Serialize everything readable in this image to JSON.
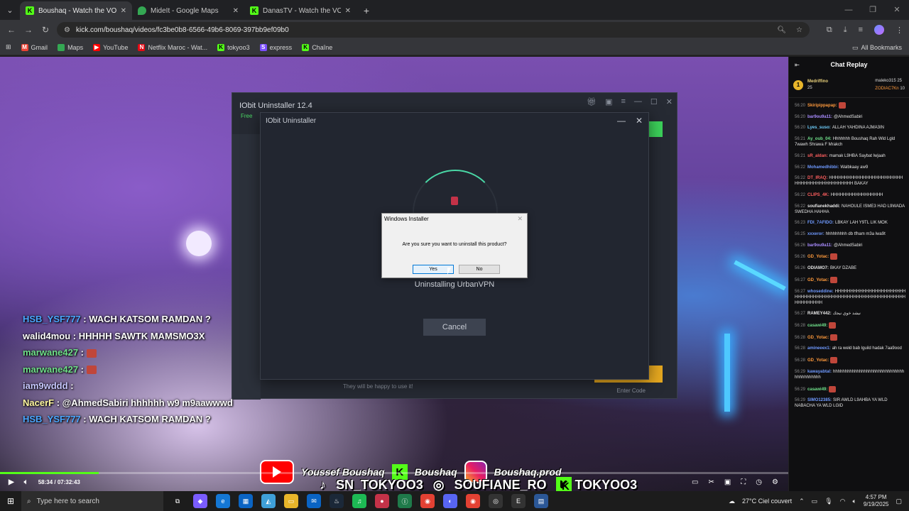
{
  "tabs": [
    {
      "title": "Boushaq - Watch the VOD on Kick",
      "icon": "kick",
      "active": true
    },
    {
      "title": "MideIt - Google Maps",
      "icon": "maps",
      "active": false
    },
    {
      "title": "DanasTV - Watch the VOD on Kick",
      "icon": "kick",
      "active": false
    }
  ],
  "address": "kick.com/boushaq/videos/fc3be0b8-6566-49b6-8069-397bb9ef09b0",
  "bookmarks": [
    "Gmail",
    "Maps",
    "YouTube",
    "Netflix Maroc - Wat...",
    "tokyoo3",
    "express",
    "Chaîne"
  ],
  "all_bookmarks": "All Bookmarks",
  "overlay_chat": [
    {
      "user": "HSB_YSF777",
      "text": " : WACH KATSOM RAMDAN ?"
    },
    {
      "user": "walid4mou",
      "text": " : HHHHH SAWTK MAMSMO3X"
    },
    {
      "user": "marwane427",
      "text": " : "
    },
    {
      "user": "marwane427",
      "text": " : "
    },
    {
      "user": "iam9wddd",
      "text": " : "
    },
    {
      "user": "NacerF",
      "text": " : @AhmedSabiri hhhhhh w9 m9aawwwd"
    },
    {
      "user": "HSB_YSF777",
      "text": " : WACH KATSOM RAMDAN ?"
    }
  ],
  "iobit": {
    "title": "IObit Uninstaller 12.4",
    "free": "Free",
    "dialog_title": "IObit Uninstaller",
    "status": "Uninstalling UrbanVPN",
    "cancel": "Cancel",
    "footer": "They will be happy to use it!",
    "footer2": "Enter Code"
  },
  "windows_installer": {
    "title": "Windows Installer",
    "message": "Are you sure you want to uninstall this product?",
    "yes": "Yes",
    "no": "No"
  },
  "banner": {
    "youtube": "Youssef Boushaq",
    "kick": "Boushaq",
    "instagram": "Boushaq.prod",
    "tiktok": "SN_TOKYOO3",
    "instagram2": "SOUFIANE_RO",
    "kick2": "TOKYOO3"
  },
  "player": {
    "time": "58:34 / 07:32:43",
    "progress": 0.125
  },
  "chat_replay": {
    "title": "Chat Replay",
    "leader_name": "Medriffino",
    "leader_count": "25",
    "leader2": "maleko315",
    "leader2_count": "25",
    "leader3": "ZODIAC7Kn",
    "leader3_count": "10",
    "messages": [
      {
        "t": "56:20",
        "n": "Skiripippapap",
        "c": "#ff9a3c",
        "m": ""
      },
      {
        "t": "56:20",
        "n": "bar9ou9a11",
        "c": "#a98cff",
        "m": "@AhmedSabiri"
      },
      {
        "t": "56:20",
        "n": "Lyes_suso",
        "c": "#6fd0ff",
        "m": "ALLAH YAHDINA AJMA3IN"
      },
      {
        "t": "56:21",
        "n": "Ay_oub_04",
        "c": "#6fe08a",
        "m": "Hhhhhhh Boushaq Rah Wld Lgld 7wawh Shrawa F Mrakch"
      },
      {
        "t": "56:21",
        "n": "sR_aldan",
        "c": "#ff5f5f",
        "m": "mamak L9HBA Saybat lwjaah"
      },
      {
        "t": "56:22",
        "n": "Mohamedhibbi",
        "c": "#6f9aff",
        "m": "Walbkaay aw9"
      },
      {
        "t": "56:22",
        "n": "DT_IRAQ",
        "c": "#ff5f5f",
        "m": "HHHHHHHHHHHHHHHHHHHHHHHH HHHHHHHHHHHHHHHHHHH BAKAY"
      },
      {
        "t": "56:22",
        "n": "CLIPS_4K",
        "c": "#ff5f5f",
        "m": "HHHHHHHHHHHHHHHHH"
      },
      {
        "t": "56:22",
        "n": "soufianekhaddi",
        "c": "#e6e6e6",
        "m": "NAHOULE ISME3 HAD L9WADA SWEDHA HAHHA"
      },
      {
        "t": "56:23",
        "n": "FDI_7AFIDO",
        "c": "#6f9aff",
        "m": "LBKAY LAH Y9TL LIK MOK"
      },
      {
        "t": "56:25",
        "n": "xxxeror",
        "c": "#6f9aff",
        "m": "hhhhhhhhh db tfham m3a lwa9t"
      },
      {
        "t": "56:26",
        "n": "bar9ou9a11",
        "c": "#a98cff",
        "m": "@AhmedSabiri"
      },
      {
        "t": "56:26",
        "n": "GD_Yotac",
        "c": "#ff9a3c",
        "m": ""
      },
      {
        "t": "56:26",
        "n": "ODIAMO7",
        "c": "#e6e6e6",
        "m": "BKAY DZABE"
      },
      {
        "t": "56:27",
        "n": "GD_Yotac",
        "c": "#ff9a3c",
        "m": ""
      },
      {
        "t": "56:27",
        "n": "whoseddine",
        "c": "#6f9aff",
        "m": "HHHHHHHHHHHHHHHHHHHHHHHHHHHHHHHHHHHHHHHHHHHHHHHHHHHHHHHHHHHHHHHHHHHH"
      },
      {
        "t": "56:27",
        "n": "RAMEY442",
        "c": "#e6e6e6",
        "m": "نيشد خوي نيجك"
      },
      {
        "t": "56:28",
        "n": "casawi49",
        "c": "#6fe08a",
        "m": ""
      },
      {
        "t": "56:28",
        "n": "GD_Yotac",
        "c": "#ff9a3c",
        "m": ""
      },
      {
        "t": "56:28",
        "n": "amineeex1",
        "c": "#6f9aff",
        "m": "ah ra weld bab lguild hadak 7aa9ood"
      },
      {
        "t": "56:28",
        "n": "GD_Yotac",
        "c": "#ff9a3c",
        "m": ""
      },
      {
        "t": "56:29",
        "n": "kawayabtal",
        "c": "#6f9aff",
        "m": "hhhhhhhhhhhhhhhhhhhhhhhhhhhhhhhhhhhhhhhhh"
      },
      {
        "t": "56:29",
        "n": "casawi49",
        "c": "#6fe08a",
        "m": ""
      },
      {
        "t": "56:29",
        "n": "SIMO12385",
        "c": "#6f9aff",
        "m": "SIR AWLD L9AHBA YA WLD NABACHA YA WLD LGID"
      }
    ]
  },
  "taskbar": {
    "search_placeholder": "Type here to search",
    "weather": "27°C Ciel couvert",
    "time": "4:57 PM",
    "date": "9/19/2025"
  }
}
